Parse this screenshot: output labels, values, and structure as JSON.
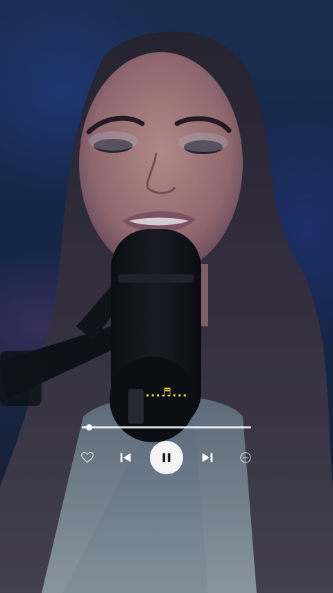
{
  "player": {
    "lyric_text": "...♬...",
    "progress": 0.04,
    "state": "playing",
    "icons": {
      "like": "heart-outline-icon",
      "previous": "skip-previous-icon",
      "toggle": "pause-icon",
      "next": "skip-next-icon",
      "remove": "minus-circle-icon"
    }
  },
  "colors": {
    "lyric": "#f2cf38",
    "controls": "#ffffff",
    "play_button_bg": "#f3f3f3"
  }
}
